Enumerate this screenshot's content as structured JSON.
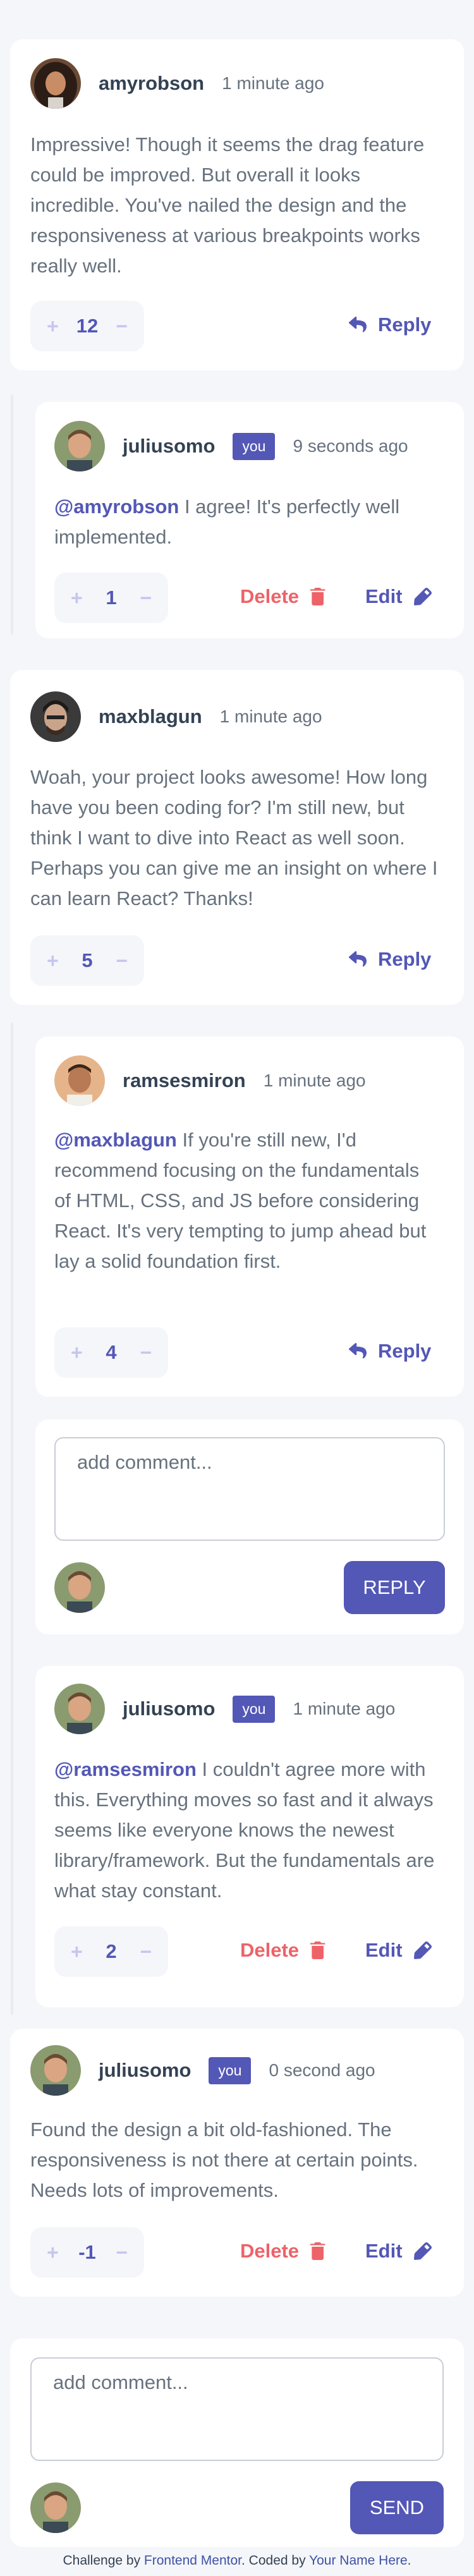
{
  "colors": {
    "page_bg": "#f5f6fa",
    "card_bg": "#ffffff",
    "primary": "#5357b6",
    "danger": "#ed6368",
    "text_heading": "#334253",
    "text_body": "#67727e",
    "vote_bg": "#f5f6fa",
    "vote_symbol": "#c5c6ef"
  },
  "vote_controls": {
    "plus": "+",
    "minus": "−"
  },
  "actions": {
    "reply": "Reply",
    "delete": "Delete",
    "edit": "Edit"
  },
  "icons": {
    "reply": "reply-arrow-icon",
    "delete": "trash-icon",
    "edit": "pencil-icon"
  },
  "badge": {
    "you": "you"
  },
  "comments": [
    {
      "username": "amyrobson",
      "time": "1 minute ago",
      "text": "Impressive! Though it seems the drag feature could be improved. But overall it looks incredible. You've nailed the design and the responsiveness at various breakpoints works really well.",
      "score": "12"
    },
    {
      "username": "juliusomo",
      "time": "9 seconds ago",
      "mention": "@amyrobson",
      "text": " I agree! It's perfectly well implemented.",
      "score": "1"
    },
    {
      "username": "maxblagun",
      "time": "1 minute ago",
      "text": "Woah, your project looks awesome! How long have you been coding for? I'm still new, but think I want to dive into React as well soon. Perhaps you can give me an insight on where I can learn React? Thanks!",
      "score": "5"
    },
    {
      "username": "ramsesmiron",
      "time": "1 minute ago",
      "mention": "@maxblagun",
      "text": " If you're still new, I'd recommend focusing on the fundamentals of HTML, CSS, and JS before considering React. It's very tempting to jump ahead but lay a solid foundation first.",
      "score": "4"
    },
    {
      "username": "juliusomo",
      "time": "1 minute ago",
      "mention": "@ramsesmiron",
      "text": " I couldn't agree more with this. Everything moves so fast and it always seems like everyone knows the newest library/framework. But the fundamentals are what stay constant.",
      "score": "2"
    },
    {
      "username": "juliusomo",
      "time": "0 second ago",
      "text": "Found the design a bit old-fashioned. The responsiveness is not there at certain points. Needs lots of improvements.",
      "score": "-1"
    }
  ],
  "reply_form": {
    "placeholder": "add comment...",
    "button": "REPLY"
  },
  "new_comment_form": {
    "placeholder": "add comment...",
    "button": "SEND"
  },
  "attribution": {
    "prefix": "Challenge by ",
    "link1": "Frontend Mentor",
    "middle": ". Coded by ",
    "link2": "Your Name Here",
    "suffix": "."
  }
}
